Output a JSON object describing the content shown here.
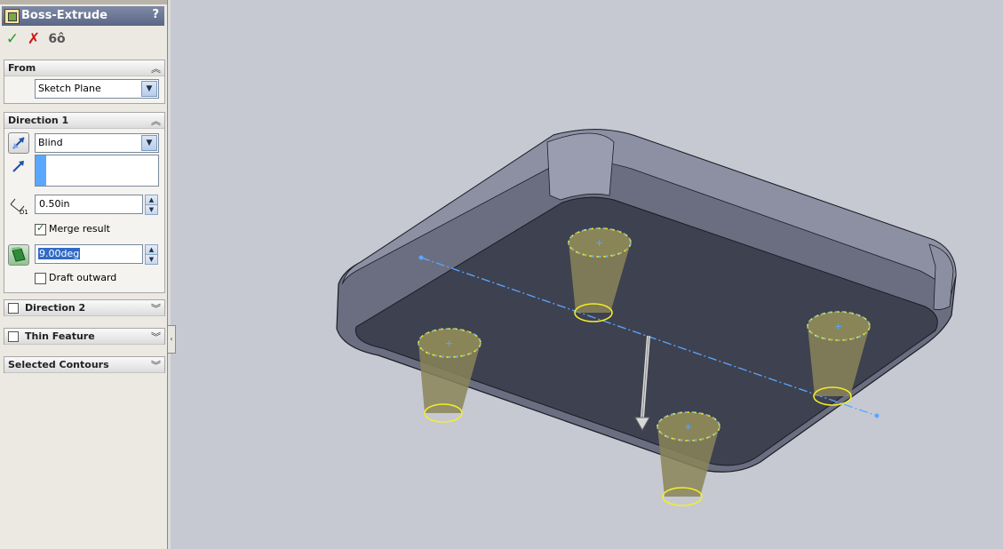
{
  "panel": {
    "title": "Boss-Extrude",
    "help": "?",
    "actions": {
      "ok": "✓",
      "cancel": "✗",
      "preview": "6ô"
    }
  },
  "from": {
    "title": "From",
    "start_condition": "Sketch Plane"
  },
  "direction1": {
    "title": "Direction 1",
    "end_condition": "Blind",
    "depth": "0.50in",
    "merge_label": "Merge result",
    "merge_checked": true,
    "draft_angle": "9.00deg",
    "draft_outward_label": "Draft outward",
    "draft_outward_checked": false
  },
  "direction2": {
    "title": "Direction 2"
  },
  "thin_feature": {
    "title": "Thin Feature"
  },
  "selected_contours": {
    "title": "Selected Contours"
  },
  "colors": {
    "viewport_bg": "#c6c9d2",
    "body_dark": "#3e4150",
    "rim": "#6b6e80",
    "boss_fill": "#8a8558",
    "sketch_yellow": "#f2ee2a",
    "axis_blue": "#5aa7ff"
  }
}
